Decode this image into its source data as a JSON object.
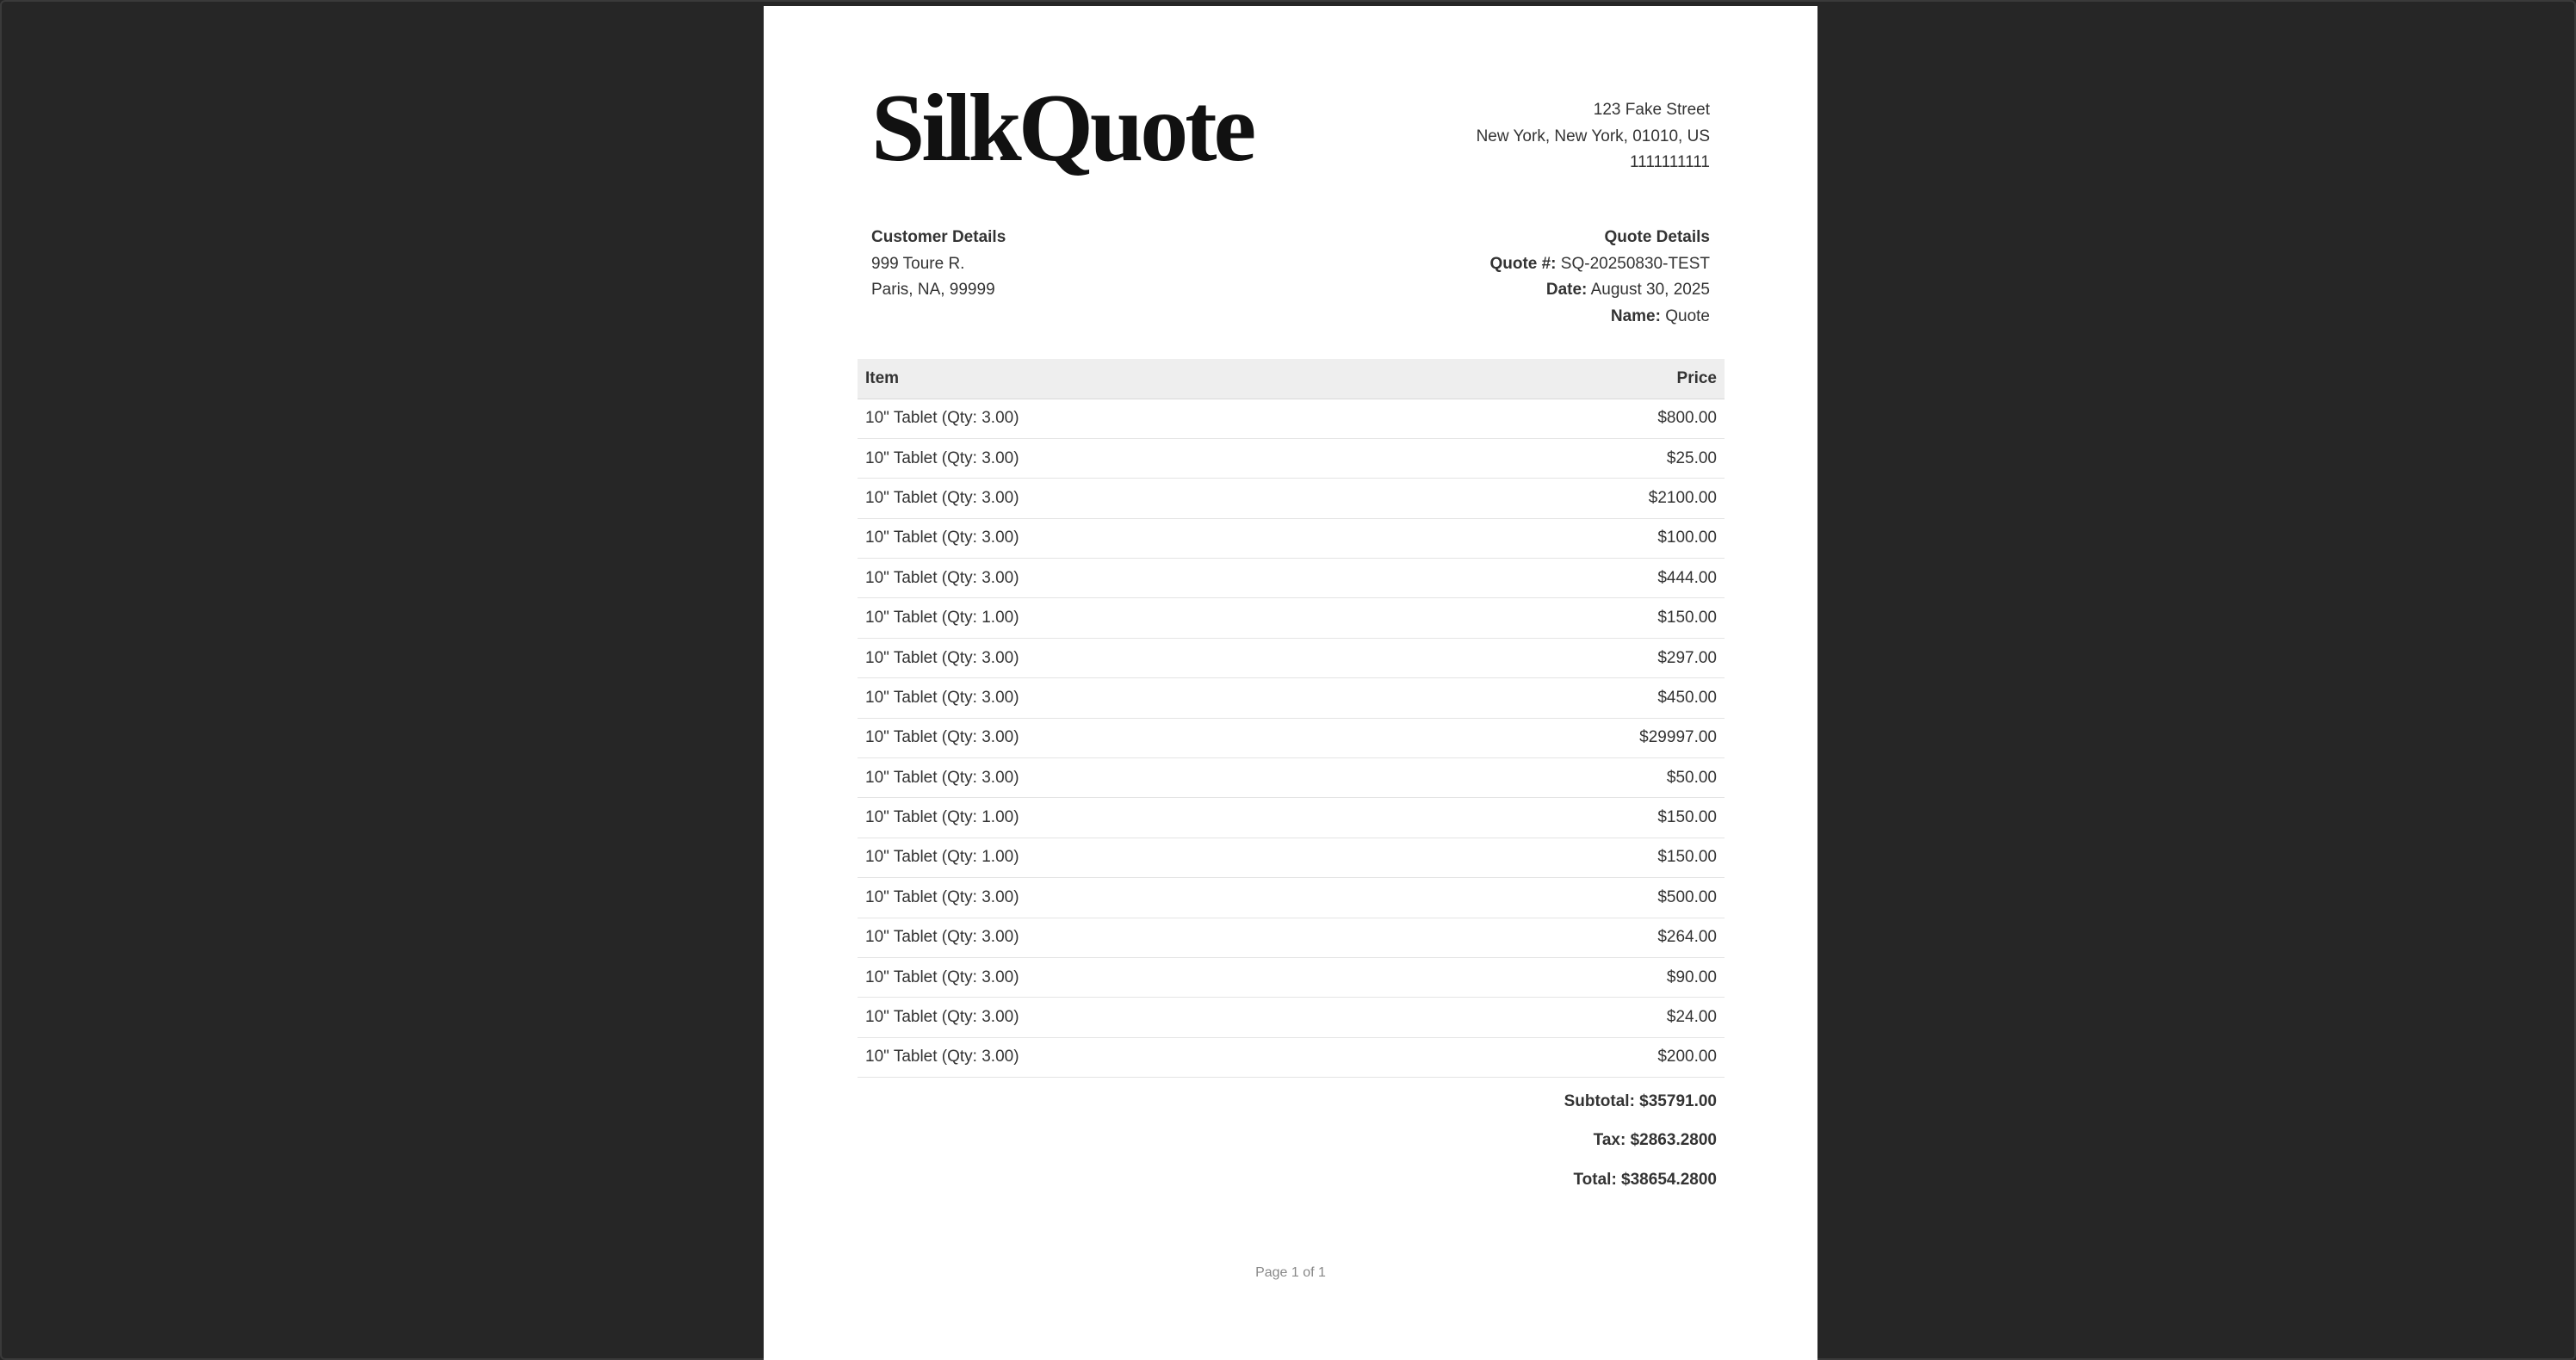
{
  "company": {
    "logo_text": "SilkQuote",
    "address_lines": [
      "123 Fake Street",
      "New York, New York, 01010, US",
      "1111111111"
    ]
  },
  "customer": {
    "heading": "Customer Details",
    "lines": [
      "999 Toure R.",
      "Paris, NA, 99999"
    ]
  },
  "quote": {
    "heading": "Quote Details",
    "number_label": "Quote #:",
    "number_value": "SQ-20250830-TEST",
    "date_label": "Date:",
    "date_value": "August 30, 2025",
    "name_label": "Name:",
    "name_value": "Quote"
  },
  "table": {
    "headers": {
      "item": "Item",
      "price": "Price"
    },
    "rows": [
      {
        "item": "10\" Tablet (Qty: 3.00)",
        "price": "$800.00"
      },
      {
        "item": "10\" Tablet (Qty: 3.00)",
        "price": "$25.00"
      },
      {
        "item": "10\" Tablet (Qty: 3.00)",
        "price": "$2100.00"
      },
      {
        "item": "10\" Tablet (Qty: 3.00)",
        "price": "$100.00"
      },
      {
        "item": "10\" Tablet (Qty: 3.00)",
        "price": "$444.00"
      },
      {
        "item": "10\" Tablet (Qty: 1.00)",
        "price": "$150.00"
      },
      {
        "item": "10\" Tablet (Qty: 3.00)",
        "price": "$297.00"
      },
      {
        "item": "10\" Tablet (Qty: 3.00)",
        "price": "$450.00"
      },
      {
        "item": "10\" Tablet (Qty: 3.00)",
        "price": "$29997.00"
      },
      {
        "item": "10\" Tablet (Qty: 3.00)",
        "price": "$50.00"
      },
      {
        "item": "10\" Tablet (Qty: 1.00)",
        "price": "$150.00"
      },
      {
        "item": "10\" Tablet (Qty: 1.00)",
        "price": "$150.00"
      },
      {
        "item": "10\" Tablet (Qty: 3.00)",
        "price": "$500.00"
      },
      {
        "item": "10\" Tablet (Qty: 3.00)",
        "price": "$264.00"
      },
      {
        "item": "10\" Tablet (Qty: 3.00)",
        "price": "$90.00"
      },
      {
        "item": "10\" Tablet (Qty: 3.00)",
        "price": "$24.00"
      },
      {
        "item": "10\" Tablet (Qty: 3.00)",
        "price": "$200.00"
      }
    ]
  },
  "totals": {
    "subtotal": "Subtotal: $35791.00",
    "tax": "Tax: $2863.2800",
    "total": "Total: $38654.2800"
  },
  "footer": {
    "page_label": "Page 1 of 1"
  },
  "colors": {
    "viewer_background": "#262626",
    "page_background": "#ffffff",
    "header_row_background": "#eeeeee",
    "text": "#333333"
  }
}
